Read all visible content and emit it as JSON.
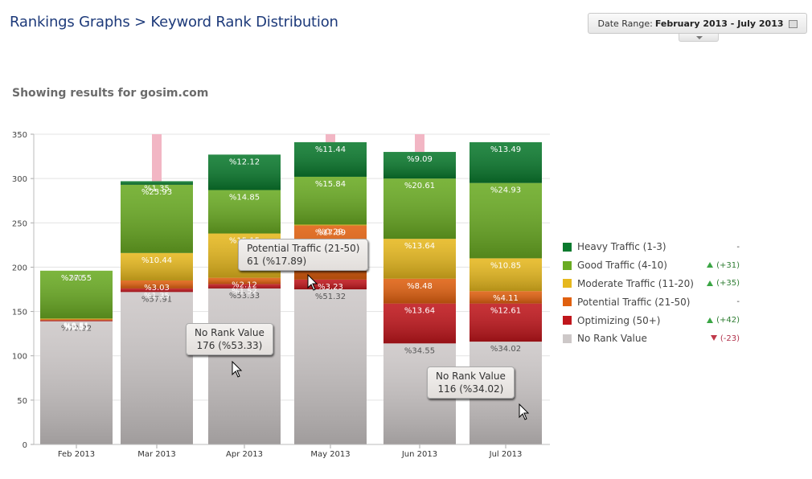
{
  "header": {
    "title": "Rankings Graphs > Keyword Rank Distribution",
    "date_range_label": "Date Range:",
    "date_range_value": "February 2013 - July 2013",
    "calendar_icon": "calendar-icon",
    "toggle_icon": "chevron-down-icon"
  },
  "subtitle": "Showing results for gosim.com",
  "legend": [
    {
      "label": "Heavy Traffic (1-3)",
      "color": "#0b7a2e",
      "change": "-",
      "trend": "none"
    },
    {
      "label": "Good Traffic (4-10)",
      "color": "#6aab23",
      "change": "(+31)",
      "trend": "up"
    },
    {
      "label": "Moderate Traffic (11-20)",
      "color": "#e6b81e",
      "change": "(+35)",
      "trend": "up"
    },
    {
      "label": "Potential Traffic (21-50)",
      "color": "#e0600f",
      "change": "-",
      "trend": "none"
    },
    {
      "label": "Optimizing (50+)",
      "color": "#c0161c",
      "change": "(+42)",
      "trend": "up"
    },
    {
      "label": "No Rank Value",
      "color": "#cdc8c8",
      "change": "(-23)",
      "trend": "down"
    }
  ],
  "tooltips": [
    {
      "title": "Potential Traffic (21-50)",
      "value": "61 (%17.89)"
    },
    {
      "title": "No Rank Value",
      "value": "176 (%53.33)"
    },
    {
      "title": "No Rank Value",
      "value": "116 (%34.02)"
    }
  ],
  "chart_data": {
    "type": "bar",
    "stacked": true,
    "title": "",
    "xlabel": "",
    "ylabel": "",
    "ylim": [
      0,
      350
    ],
    "yticks": [
      0,
      50,
      100,
      150,
      200,
      250,
      300,
      350
    ],
    "grid": true,
    "legend_position": "right",
    "categories": [
      "Feb 2013",
      "Mar 2013",
      "Apr 2013",
      "May 2013",
      "Jun 2013",
      "Jul 2013"
    ],
    "series": [
      {
        "name": "No Rank Value",
        "color": "#cdc8c8",
        "values": [
          139,
          172,
          176,
          175,
          114,
          116
        ],
        "labels": [
          "%70.92",
          "%57.91",
          "%53.33",
          "%51.32",
          "%34.55",
          "%34.02"
        ],
        "dark_label": true
      },
      {
        "name": "Optimizing (50+)",
        "color": "#c0161c",
        "values": [
          1,
          4,
          5,
          11,
          45,
          43
        ],
        "labels": [
          "%0.51",
          "%1.35",
          "%1.52",
          "%3.23",
          "%13.64",
          "%12.61"
        ]
      },
      {
        "name": "Potential Traffic (21-50)",
        "color": "#e0600f",
        "values": [
          1,
          9,
          7,
          61,
          28,
          14
        ],
        "labels": [
          "%0.51",
          "%3.03",
          "%2.12",
          "%17.89",
          "%8.48",
          "%4.11"
        ]
      },
      {
        "name": "Moderate Traffic (11-20)",
        "color": "#e6b81e",
        "values": [
          1,
          31,
          50,
          1,
          45,
          37
        ],
        "labels": [
          "%0.51",
          "%10.44",
          "%15.15",
          "%0.29",
          "%13.64",
          "%10.85"
        ]
      },
      {
        "name": "Good Traffic (4-10)",
        "color": "#6aab23",
        "values": [
          54,
          77,
          49,
          54,
          68,
          85
        ],
        "labels": [
          "%27.55",
          "%25.93",
          "%14.85",
          "%15.84",
          "%20.61",
          "%24.93"
        ]
      },
      {
        "name": "Heavy Traffic (1-3)",
        "color": "#0b7a2e",
        "values": [
          0,
          4,
          40,
          39,
          30,
          46
        ],
        "labels": [
          "%0",
          "%1.35",
          "%12.12",
          "%11.44",
          "%9.09",
          "%13.49"
        ]
      }
    ]
  }
}
